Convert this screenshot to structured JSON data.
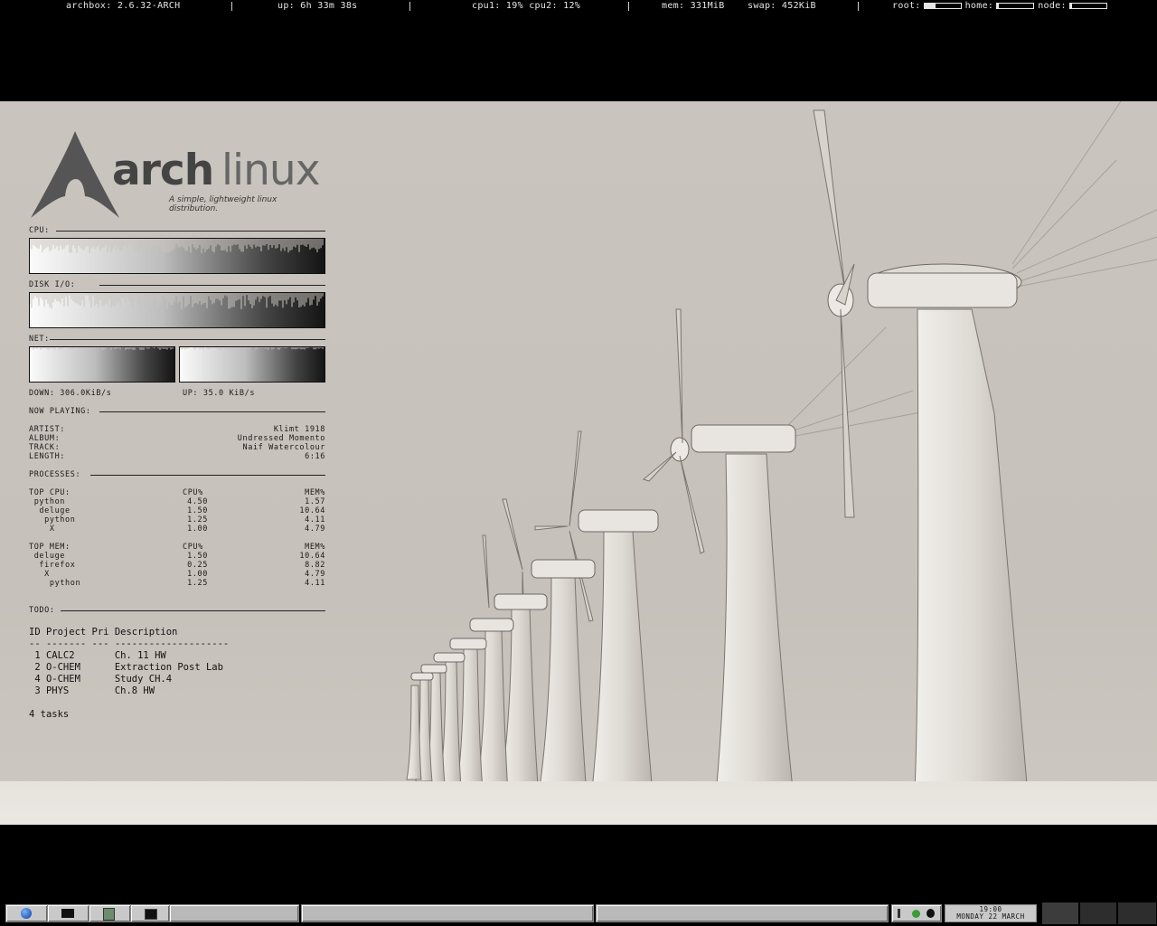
{
  "topbar": {
    "host": "archbox: 2.6.32-ARCH",
    "uptime": "up: 6h 33m 38s",
    "cpu": "cpu1: 19% cpu2: 12%",
    "mem": "mem: 331MiB",
    "swap": "swap: 452KiB",
    "root_label": "root:",
    "home_label": "home:",
    "node_label": "node:",
    "root_used_fraction": 0.3,
    "home_used_fraction": 0.05,
    "node_used_fraction": 0.05
  },
  "logo": {
    "word_bold": "arch",
    "word_light": "linux",
    "tagline": "A simple, lightweight linux distribution."
  },
  "conky": {
    "cpu_label": "CPU:",
    "disk_label": "DISK I/O:",
    "net_label": "NET:",
    "down": "DOWN: 306.0KiB/s",
    "up": "UP: 35.0 KiB/s",
    "now_playing_label": "NOW PLAYING:",
    "artist_label": "ARTIST:",
    "artist": "Klimt 1918",
    "album_label": "ALBUM:",
    "album": "Undressed Momento",
    "track_label": "TRACK:",
    "track": "Naif Watercolour",
    "length_label": "LENGTH:",
    "length": "6:16",
    "processes_label": "PROCESSES:",
    "top_cpu": {
      "title": "TOP CPU:",
      "col_cpu": "CPU%",
      "col_mem": "MEM%",
      "rows": [
        {
          "name": " python",
          "cpu": "4.50",
          "mem": "1.57"
        },
        {
          "name": "  deluge",
          "cpu": "1.50",
          "mem": "10.64"
        },
        {
          "name": "   python",
          "cpu": "1.25",
          "mem": "4.11"
        },
        {
          "name": "    X",
          "cpu": "1.00",
          "mem": "4.79"
        }
      ]
    },
    "top_mem": {
      "title": "TOP MEM:",
      "col_cpu": "CPU%",
      "col_mem": "MEM%",
      "rows": [
        {
          "name": " deluge",
          "cpu": "1.50",
          "mem": "10.64"
        },
        {
          "name": "  firefox",
          "cpu": "0.25",
          "mem": "8.82"
        },
        {
          "name": "   X",
          "cpu": "1.00",
          "mem": "4.79"
        },
        {
          "name": "    python",
          "cpu": "1.25",
          "mem": "4.11"
        }
      ]
    },
    "todo_label": "TODO:",
    "todo_header": "ID Project Pri Description",
    "todo_sep": "-- ------- --- --------------------",
    "todo_rows": [
      " 1 CALC2       Ch. 11 HW",
      " 2 O-CHEM      Extraction Post Lab",
      " 4 O-CHEM      Study CH.4",
      " 3 PHYS        Ch.8 HW"
    ],
    "todo_count": "4 tasks"
  },
  "taskbar": {
    "clock_time": "19:00",
    "clock_date": "MONDAY 22 MARCH",
    "launchers": [
      "globe-icon",
      "folder-icon",
      "files-icon",
      "terminal-icon"
    ]
  }
}
